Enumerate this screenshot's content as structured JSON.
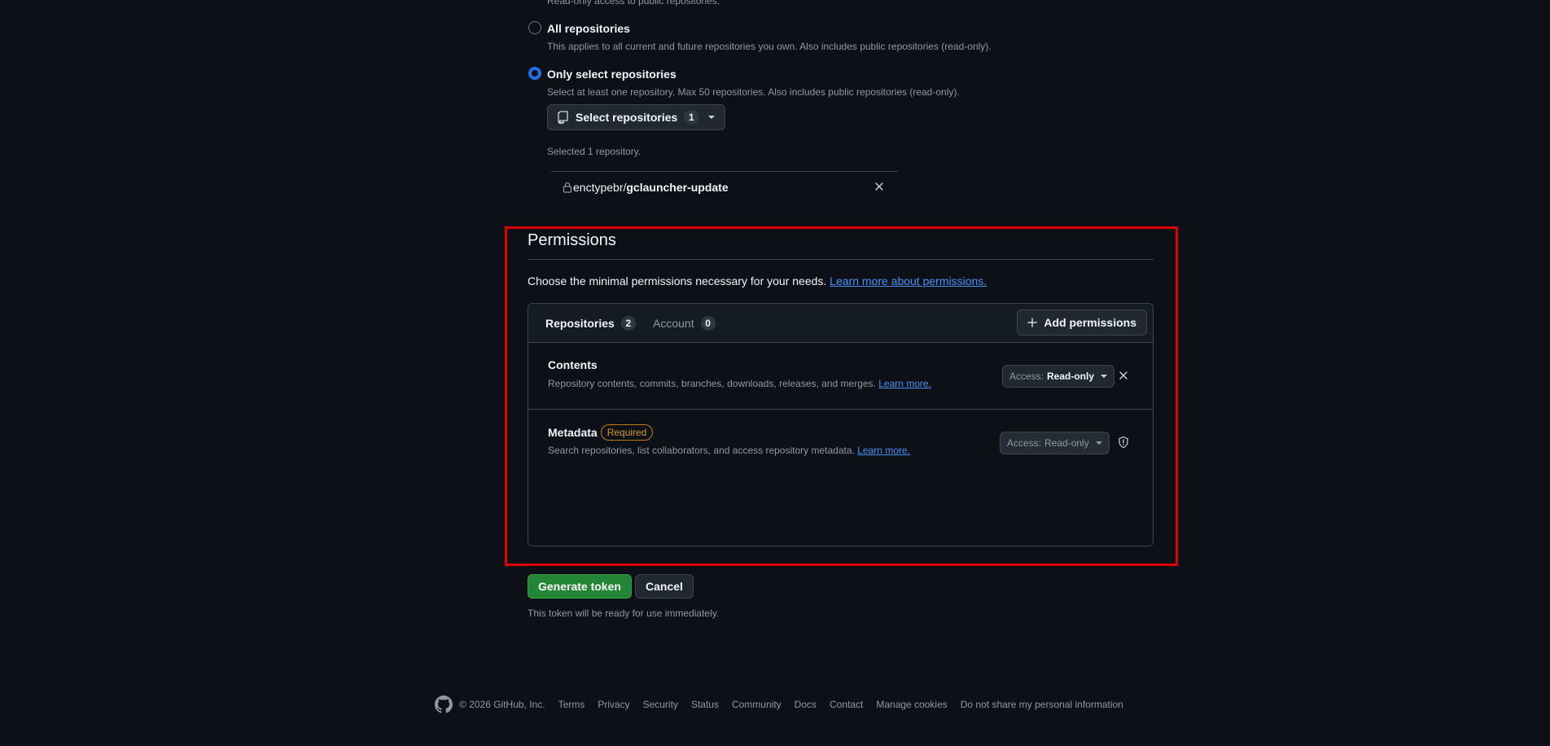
{
  "repo_access": {
    "partial_text": "Read-only access to public repositories.",
    "all_repos": {
      "title": "All repositories",
      "desc": "This applies to all current and future repositories you own. Also includes public repositories (read-only)."
    },
    "only_select": {
      "title": "Only select repositories",
      "desc": "Select at least one repository. Max 50 repositories. Also includes public repositories (read-only)."
    },
    "select_button": {
      "label": "Select repositories",
      "count": "1"
    },
    "selected_count_text": "Selected 1 repository.",
    "selected_repo": {
      "owner": "enctypebr/",
      "name": "gclauncher-update"
    }
  },
  "permissions": {
    "title": "Permissions",
    "intro": "Choose the minimal permissions necessary for your needs.",
    "intro_link": "Learn more about permissions.",
    "tabs": [
      {
        "label": "Repositories",
        "count": "2"
      },
      {
        "label": "Account",
        "count": "0"
      }
    ],
    "add_button": "Add permissions",
    "rows": [
      {
        "name": "Contents",
        "desc": "Repository contents, commits, branches, downloads, releases, and merges.",
        "link": "Learn more.",
        "access_prefix": "Access:",
        "access_value": "Read-only"
      },
      {
        "name": "Metadata",
        "badge": "Required",
        "desc": "Search repositories, list collaborators, and access repository metadata.",
        "link": "Learn more.",
        "access_prefix": "Access:",
        "access_value": "Read-only"
      }
    ]
  },
  "actions": {
    "generate": "Generate token",
    "cancel": "Cancel",
    "note": "This token will be ready for use immediately."
  },
  "footer": {
    "copyright": "© 2026 GitHub, Inc.",
    "links": [
      "Terms",
      "Privacy",
      "Security",
      "Status",
      "Community",
      "Docs",
      "Contact",
      "Manage cookies",
      "Do not share my personal information"
    ]
  }
}
